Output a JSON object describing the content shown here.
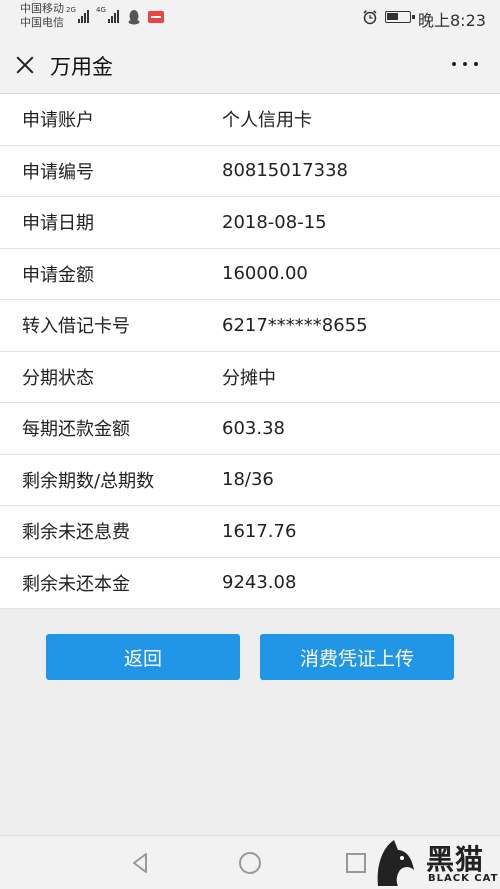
{
  "status_bar": {
    "carrier_1": "中国移动",
    "carrier_2": "中国电信",
    "network_1": "2G",
    "network_2": "4G",
    "time": "晚上8:23",
    "battery_level": 0.55
  },
  "header": {
    "title": "万用金"
  },
  "details": [
    {
      "label": "申请账户",
      "value": "个人信用卡"
    },
    {
      "label": "申请编号",
      "value": "80815017338"
    },
    {
      "label": "申请日期",
      "value": "2018-08-15"
    },
    {
      "label": "申请金额",
      "value": "16000.00"
    },
    {
      "label": "转入借记卡号",
      "value": "6217******8655"
    },
    {
      "label": "分期状态",
      "value": "分摊中"
    },
    {
      "label": "每期还款金额",
      "value": "603.38"
    },
    {
      "label": "剩余期数/总期数",
      "value": "18/36"
    },
    {
      "label": "剩余未还息费",
      "value": "1617.76"
    },
    {
      "label": "剩余未还本金",
      "value": "9243.08"
    }
  ],
  "actions": {
    "back_label": "返回",
    "voucher_label": "消费凭证上传"
  },
  "watermark": {
    "text": "黑猫",
    "sub": "BLACK CAT"
  },
  "colors": {
    "accent": "#2196e6"
  }
}
